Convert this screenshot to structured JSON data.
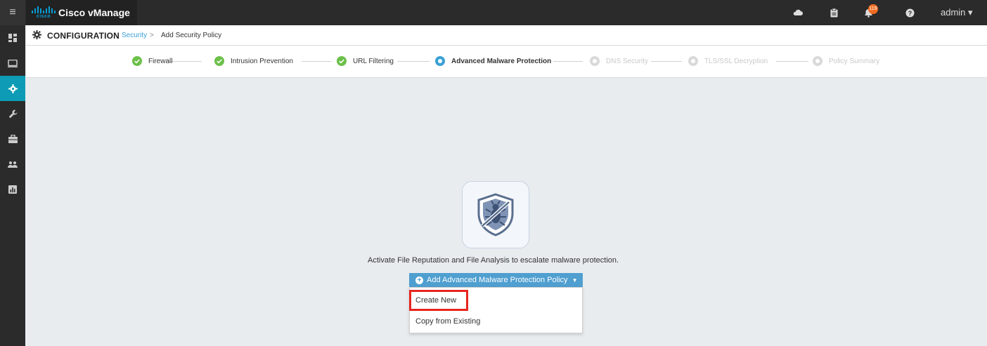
{
  "topbar": {
    "menu_icon": "hamburger-icon",
    "brand_logo_text": "cisco",
    "brand_name": "Cisco vManage",
    "icons": [
      "cloud-icon",
      "clipboard-icon",
      "bell-icon",
      "help-icon"
    ],
    "notification_count": "119",
    "user_label": "admin ▾"
  },
  "sidebar": {
    "items": [
      {
        "icon": "dashboard-icon",
        "active": false
      },
      {
        "icon": "monitor-icon",
        "active": false
      },
      {
        "icon": "gear-icon",
        "active": true
      },
      {
        "icon": "wrench-icon",
        "active": false
      },
      {
        "icon": "briefcase-icon",
        "active": false
      },
      {
        "icon": "users-icon",
        "active": false
      },
      {
        "icon": "analytics-icon",
        "active": false
      }
    ],
    "active_color": "#0d9bb5"
  },
  "breadcrumb": {
    "title": "CONFIGURATION",
    "link": "Security",
    "separator": ">",
    "current": "Add Security Policy"
  },
  "steps": [
    {
      "label": "Firewall",
      "state": "done"
    },
    {
      "label": "Intrusion Prevention",
      "state": "done"
    },
    {
      "label": "URL Filtering",
      "state": "done"
    },
    {
      "label": "Advanced Malware Protection",
      "state": "active"
    },
    {
      "label": "DNS Security",
      "state": "pending"
    },
    {
      "label": "TLS/SSL Decryption",
      "state": "pending"
    },
    {
      "label": "Policy Summary",
      "state": "pending"
    }
  ],
  "content": {
    "hero_icon": "shield-bug-icon",
    "message": "Activate File Reputation and File Analysis to escalate malware protection.",
    "add_button_label": "Add Advanced Malware Protection Policy",
    "dropdown_items": [
      "Create New",
      "Copy from Existing"
    ],
    "highlighted_item": "Create New"
  },
  "colors": {
    "topbar": "#2b2b2b",
    "accent_blue": "#4f9fd0",
    "done_green": "#6cc04a",
    "highlight_red": "#e8251f",
    "badge_orange": "#f26b21"
  }
}
